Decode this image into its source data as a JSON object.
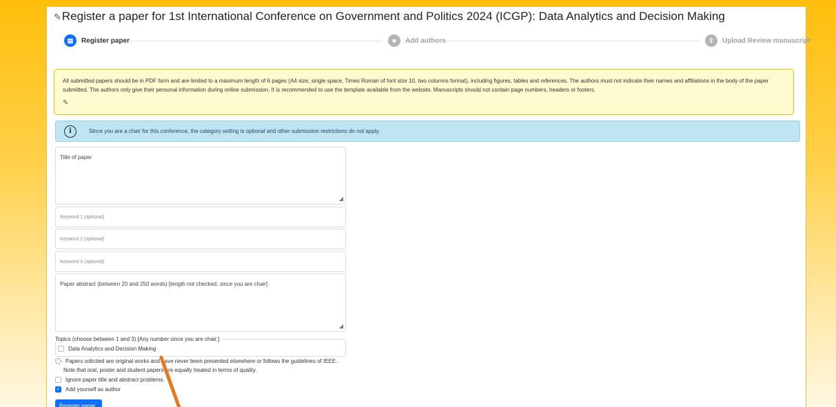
{
  "page": {
    "title": "Register a paper for 1st International Conference on Government and Politics 2024 (ICGP): Data Analytics and Decision Making",
    "title_icon": "edit-icon"
  },
  "stepper": {
    "steps": [
      {
        "label": "Register paper",
        "state": "active",
        "icon": "paper-icon"
      },
      {
        "label": "Add authors",
        "state": "inactive",
        "icon": "users-icon"
      },
      {
        "label": "Upload Review manuscript",
        "state": "inactive",
        "icon": "upload-icon"
      }
    ]
  },
  "instructions": {
    "text": "All submitted papers should be in PDF form and are limited to a maximum length of 6 pages (A4 size, single space, Times Roman of font size 10, two columns format), including figures, tables and references. The authors must not indicate their names and affiliations in the body of the paper submitted. The authors only give their personal information during online submission. It is recommended to use the template available from the website. Manuscripts should not contain page numbers, headers or footers."
  },
  "info": {
    "text": "Since you are a chair for this conference, the category setting is optional and other submission restrictions do not apply."
  },
  "form": {
    "title_placeholder": "Title of paper",
    "keyword1_placeholder": "Keyword 1 (optional)",
    "keyword2_placeholder": "Keyword 2 (optional)",
    "keyword3_placeholder": "Keyword 3 (optional)",
    "abstract_placeholder": "Paper abstract (between 20 and 250 words) [length not checked, since you are chair]",
    "topics_legend": "Topics (choose between 1 and 3) [Any number since you are chair.]",
    "topics": [
      {
        "label": "Data Analytics and Decision Making",
        "checked": false
      }
    ],
    "originality_label": "Papers solicited are original works and have never been presented elsewhere or follows the guidelines of IEEE.",
    "originality_note": "Note that oral, poster and student papers are equally treated in terms of quality.",
    "ignore_label": "Ignore paper title and abstract problems.",
    "add_author_label": "Add yourself as author",
    "add_author_checked": true,
    "submit_label": "Register paper"
  },
  "colors": {
    "accent": "#0d6efd",
    "warning_bg": "#fffbd0",
    "info_bg": "#bfe4f2",
    "page_bg": "#ffbe0b",
    "annotation_arrow": "#e87722"
  }
}
